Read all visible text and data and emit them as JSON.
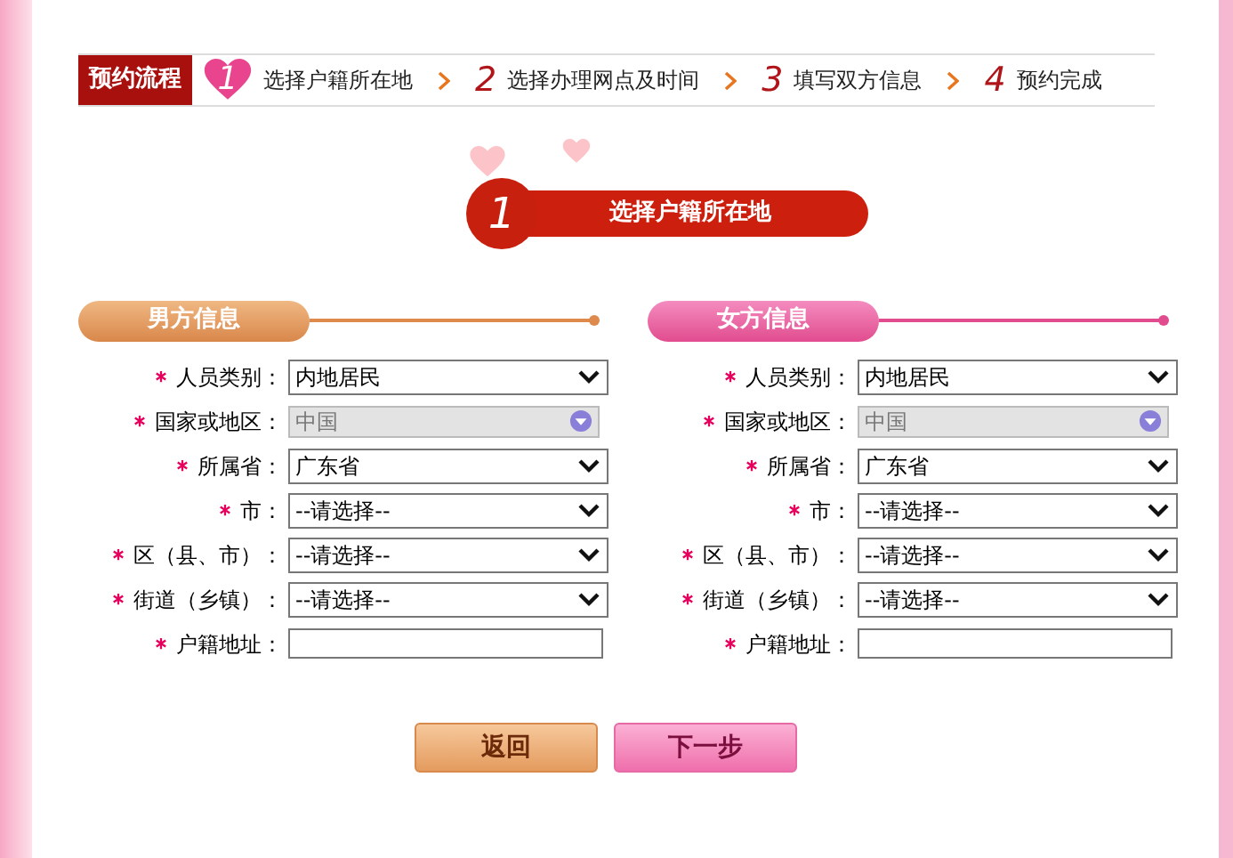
{
  "flow": {
    "title": "预约流程",
    "steps": [
      {
        "number": "1",
        "label": "选择户籍所在地",
        "selected": true
      },
      {
        "number": "2",
        "label": "选择办理网点及时间",
        "selected": false
      },
      {
        "number": "3",
        "label": "填写双方信息",
        "selected": false
      },
      {
        "number": "4",
        "label": "预约完成",
        "selected": false
      }
    ]
  },
  "current_step": {
    "number": "1",
    "label": "选择户籍所在地"
  },
  "sections": [
    {
      "title": "男方信息",
      "kind": "male",
      "fields": [
        {
          "label": "人员类别：",
          "kind": "select",
          "value": "内地居民"
        },
        {
          "label": "国家或地区：",
          "kind": "disabled_select",
          "value": "中国"
        },
        {
          "label": "所属省：",
          "kind": "select",
          "value": "广东省"
        },
        {
          "label": "市：",
          "kind": "select",
          "value": "--请选择--"
        },
        {
          "label": "区（县、市）：",
          "kind": "select",
          "value": "--请选择--"
        },
        {
          "label": "街道（乡镇）：",
          "kind": "select",
          "value": "--请选择--"
        },
        {
          "label": "户籍地址：",
          "kind": "text"
        }
      ]
    },
    {
      "title": "女方信息",
      "kind": "female",
      "fields": [
        {
          "label": "人员类别：",
          "kind": "select",
          "value": "内地居民"
        },
        {
          "label": "国家或地区：",
          "kind": "disabled_select",
          "value": "中国"
        },
        {
          "label": "所属省：",
          "kind": "select",
          "value": "广东省"
        },
        {
          "label": "市：",
          "kind": "select",
          "value": "--请选择--"
        },
        {
          "label": "区（县、市）：",
          "kind": "select",
          "value": "--请选择--"
        },
        {
          "label": "街道（乡镇）：",
          "kind": "select",
          "value": "--请选择--"
        },
        {
          "label": "户籍地址：",
          "kind": "text"
        }
      ]
    }
  ],
  "buttons": [
    {
      "label": "返回",
      "kind": "back"
    },
    {
      "label": "下一步",
      "kind": "next"
    }
  ]
}
